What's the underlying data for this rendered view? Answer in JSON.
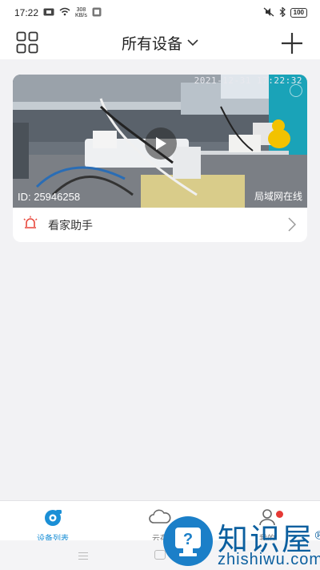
{
  "status_bar": {
    "time": "17:22",
    "speed_value": "308",
    "speed_unit": "KB/s",
    "battery": "100"
  },
  "nav": {
    "title": "所有设备"
  },
  "device": {
    "timestamp": "2021-12-31  17:22:32",
    "id_text": "ID: 25946258",
    "status": "局域网在线",
    "helper_label": "看家助手"
  },
  "tabs": [
    {
      "label": "设备列表",
      "active": true
    },
    {
      "label": "云存"
    },
    {
      "label": "我的"
    }
  ],
  "colors": {
    "accent": "#1a8fd6",
    "alarm_icon": "#e8473b",
    "badge": "#e53935"
  },
  "watermark": {
    "title": "知识屋",
    "registered": "®",
    "subtitle": "zhishiwu.com"
  }
}
